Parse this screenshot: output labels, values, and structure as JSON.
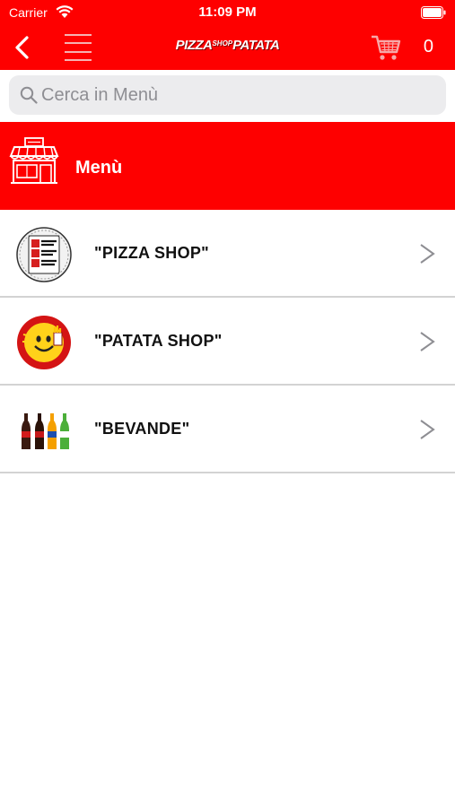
{
  "status_bar": {
    "carrier": "Carrier",
    "time": "11:09 PM"
  },
  "nav": {
    "brand_part1": "PIZZA",
    "brand_part2": "SHOP",
    "brand_part3": "PATATA",
    "cart_count": "0"
  },
  "search": {
    "placeholder": "Cerca in Menù",
    "value": ""
  },
  "menu_header": {
    "title": "Menù"
  },
  "categories": [
    {
      "label": "\"PIZZA SHOP\"",
      "image": "pizza-shop-logo"
    },
    {
      "label": "\"PATATA SHOP\"",
      "image": "patata-shop-logo"
    },
    {
      "label": "\"BEVANDE\"",
      "image": "drink-bottles"
    }
  ],
  "colors": {
    "brand_red": "#fe0000",
    "divider": "#d3d3d3",
    "search_bg": "#ececee",
    "chevron": "#8e8e93"
  }
}
